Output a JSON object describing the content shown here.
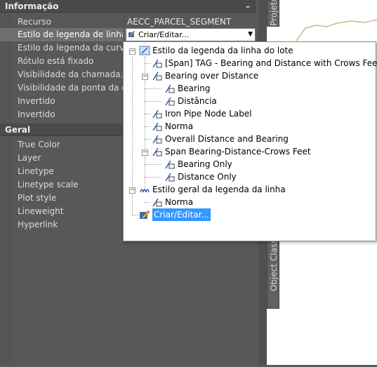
{
  "sections": {
    "info": {
      "title": "Informação"
    },
    "general": {
      "title": "Geral"
    }
  },
  "info_rows": [
    {
      "label": "Recurso",
      "value": "AECC_PARCEL_SEGMENT"
    },
    {
      "label": "Estilo de legenda de linha",
      "value": ""
    },
    {
      "label": "Estilo da legenda da curva",
      "value": ""
    },
    {
      "label": "Rótulo está fixado",
      "value": ""
    },
    {
      "label": "Visibilidade  da chamada...",
      "value": ""
    },
    {
      "label": "Visibilidade da ponta da c...",
      "value": ""
    },
    {
      "label": "Invertido",
      "value": ""
    },
    {
      "label": "Invertido",
      "value": ""
    }
  ],
  "general_rows": [
    {
      "label": "True Color"
    },
    {
      "label": "Layer"
    },
    {
      "label": "Linetype"
    },
    {
      "label": "Linetype scale"
    },
    {
      "label": "Plot style"
    },
    {
      "label": "Lineweight"
    },
    {
      "label": "Hyperlink"
    }
  ],
  "combo": {
    "value": "Criar/Editar..."
  },
  "tabs": {
    "right_top": "Projeto",
    "right_bottom": "Object Class"
  },
  "tree": {
    "root1": "Estilo da legenda da linha do lote",
    "items": [
      "[Span] TAG - Bearing and Distance with Crows Feet",
      "Bearing over Distance",
      "Bearing",
      "Distância",
      "Iron Pipe Node Label",
      "Norma",
      "Overall Distance and Bearing",
      "Span Bearing-Distance-Crows Feet",
      "Bearing Only",
      "Distance Only"
    ],
    "root2": "Estilo geral da legenda da linha",
    "root2_child": "Norma",
    "create_edit": "Criar/Editar..."
  },
  "colors": {
    "highlight": "#3399ff",
    "panel": "#585858"
  }
}
